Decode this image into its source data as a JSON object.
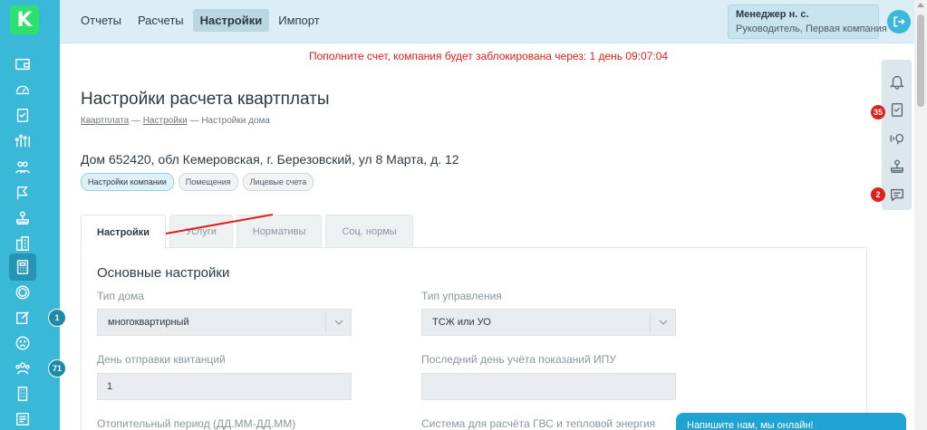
{
  "app": {
    "logo_letter": "K",
    "brand_color": "#2ee06e",
    "sidebar_color": "#3ab8d8"
  },
  "sidebar": {
    "items": [
      {
        "icon": "wallet-icon"
      },
      {
        "icon": "dashboard-icon"
      },
      {
        "icon": "checklist-icon"
      },
      {
        "icon": "chart-icon"
      },
      {
        "icon": "people-icon"
      },
      {
        "icon": "flag-icon"
      },
      {
        "icon": "stamp-icon"
      },
      {
        "icon": "buildings-icon"
      },
      {
        "icon": "calculator-icon"
      },
      {
        "icon": "coin-icon"
      },
      {
        "icon": "edit-icon"
      },
      {
        "icon": "sad-face-icon"
      },
      {
        "icon": "group-icon"
      },
      {
        "icon": "building-icon"
      },
      {
        "icon": "document-icon"
      }
    ],
    "badges": {
      "edit": "1",
      "group": "71"
    }
  },
  "topnav": {
    "items": [
      "Отчеты",
      "Расчеты",
      "Настройки",
      "Импорт"
    ],
    "active": "Настройки"
  },
  "user": {
    "name": "Менеджер н. с.",
    "role": "Руководитель, Первая компания"
  },
  "alert": {
    "text": "Пополните счет, компания будет заблокирована через: 1 день 09:07:04",
    "color": "#e0201a"
  },
  "right_panel": {
    "icons": [
      "bell-icon",
      "tasks-icon",
      "broadcast-icon",
      "stamp-icon",
      "message-icon"
    ],
    "badges": {
      "tasks": "35",
      "message": "2"
    }
  },
  "page": {
    "title": "Настройки расчета квартплаты",
    "breadcrumb": {
      "item1": "Квартплата",
      "item2": "Настройки",
      "item3": "Настройки дома",
      "sep": "—"
    },
    "house_address": "Дом 652420, обл Кемеровская, г. Березовский, ул 8 Марта, д. 12",
    "chips": [
      "Настройки компании",
      "Помещения",
      "Лицевые счета"
    ],
    "tabs": [
      "Настройки",
      "Услуги",
      "Нормативы",
      "Соц. нормы"
    ],
    "active_tab": "Настройки"
  },
  "form": {
    "section_title": "Основные настройки",
    "house_type_label": "Тип дома",
    "house_type_value": "многоквартирный",
    "management_type_label": "Тип управления",
    "management_type_value": "ТСЖ или УО",
    "send_day_label": "День отправки квитанций",
    "send_day_value": "1",
    "last_meter_day_label": "Последний день учёта показаний ИПУ",
    "last_meter_day_value": "",
    "heating_period_label": "Отопительный период (ДД.ММ-ДД.ММ)",
    "hot_water_system_label": "Система для расчёта ГВС и тепловой энергия"
  },
  "chat": {
    "label": "Напишите нам, мы онлайн!"
  }
}
